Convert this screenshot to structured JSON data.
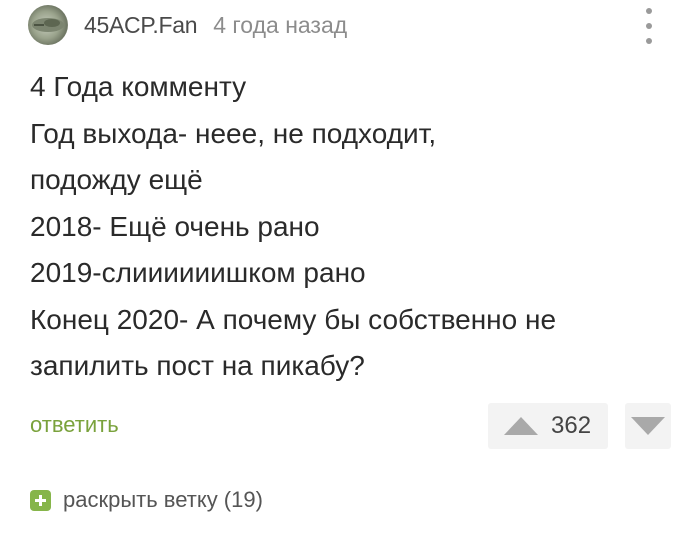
{
  "comment": {
    "author": "45ACP.Fan",
    "time": "4 года назад",
    "body_lines": [
      "4 Года комменту",
      "Год выхода- неее, не подходит,",
      "подожду ещё",
      "2018- Ещё очень рано",
      "2019-слиииииишком рано",
      "Конец 2020- А почему бы собственно не",
      "запилить пост на пикабу?"
    ],
    "reply_label": "ответить",
    "rating": "362",
    "expand_label": "раскрыть ветку (19)"
  },
  "icons": {
    "avatar": "avatar",
    "more": "vertical-dots-icon",
    "upvote": "triangle-up-icon",
    "downvote": "triangle-down-icon",
    "expand": "plus-square-icon"
  },
  "colors": {
    "accent_green": "#7aa23c",
    "plus_green": "#86b54a",
    "vote_bg": "#f3f3f3",
    "arrow": "#a9a9a9"
  }
}
